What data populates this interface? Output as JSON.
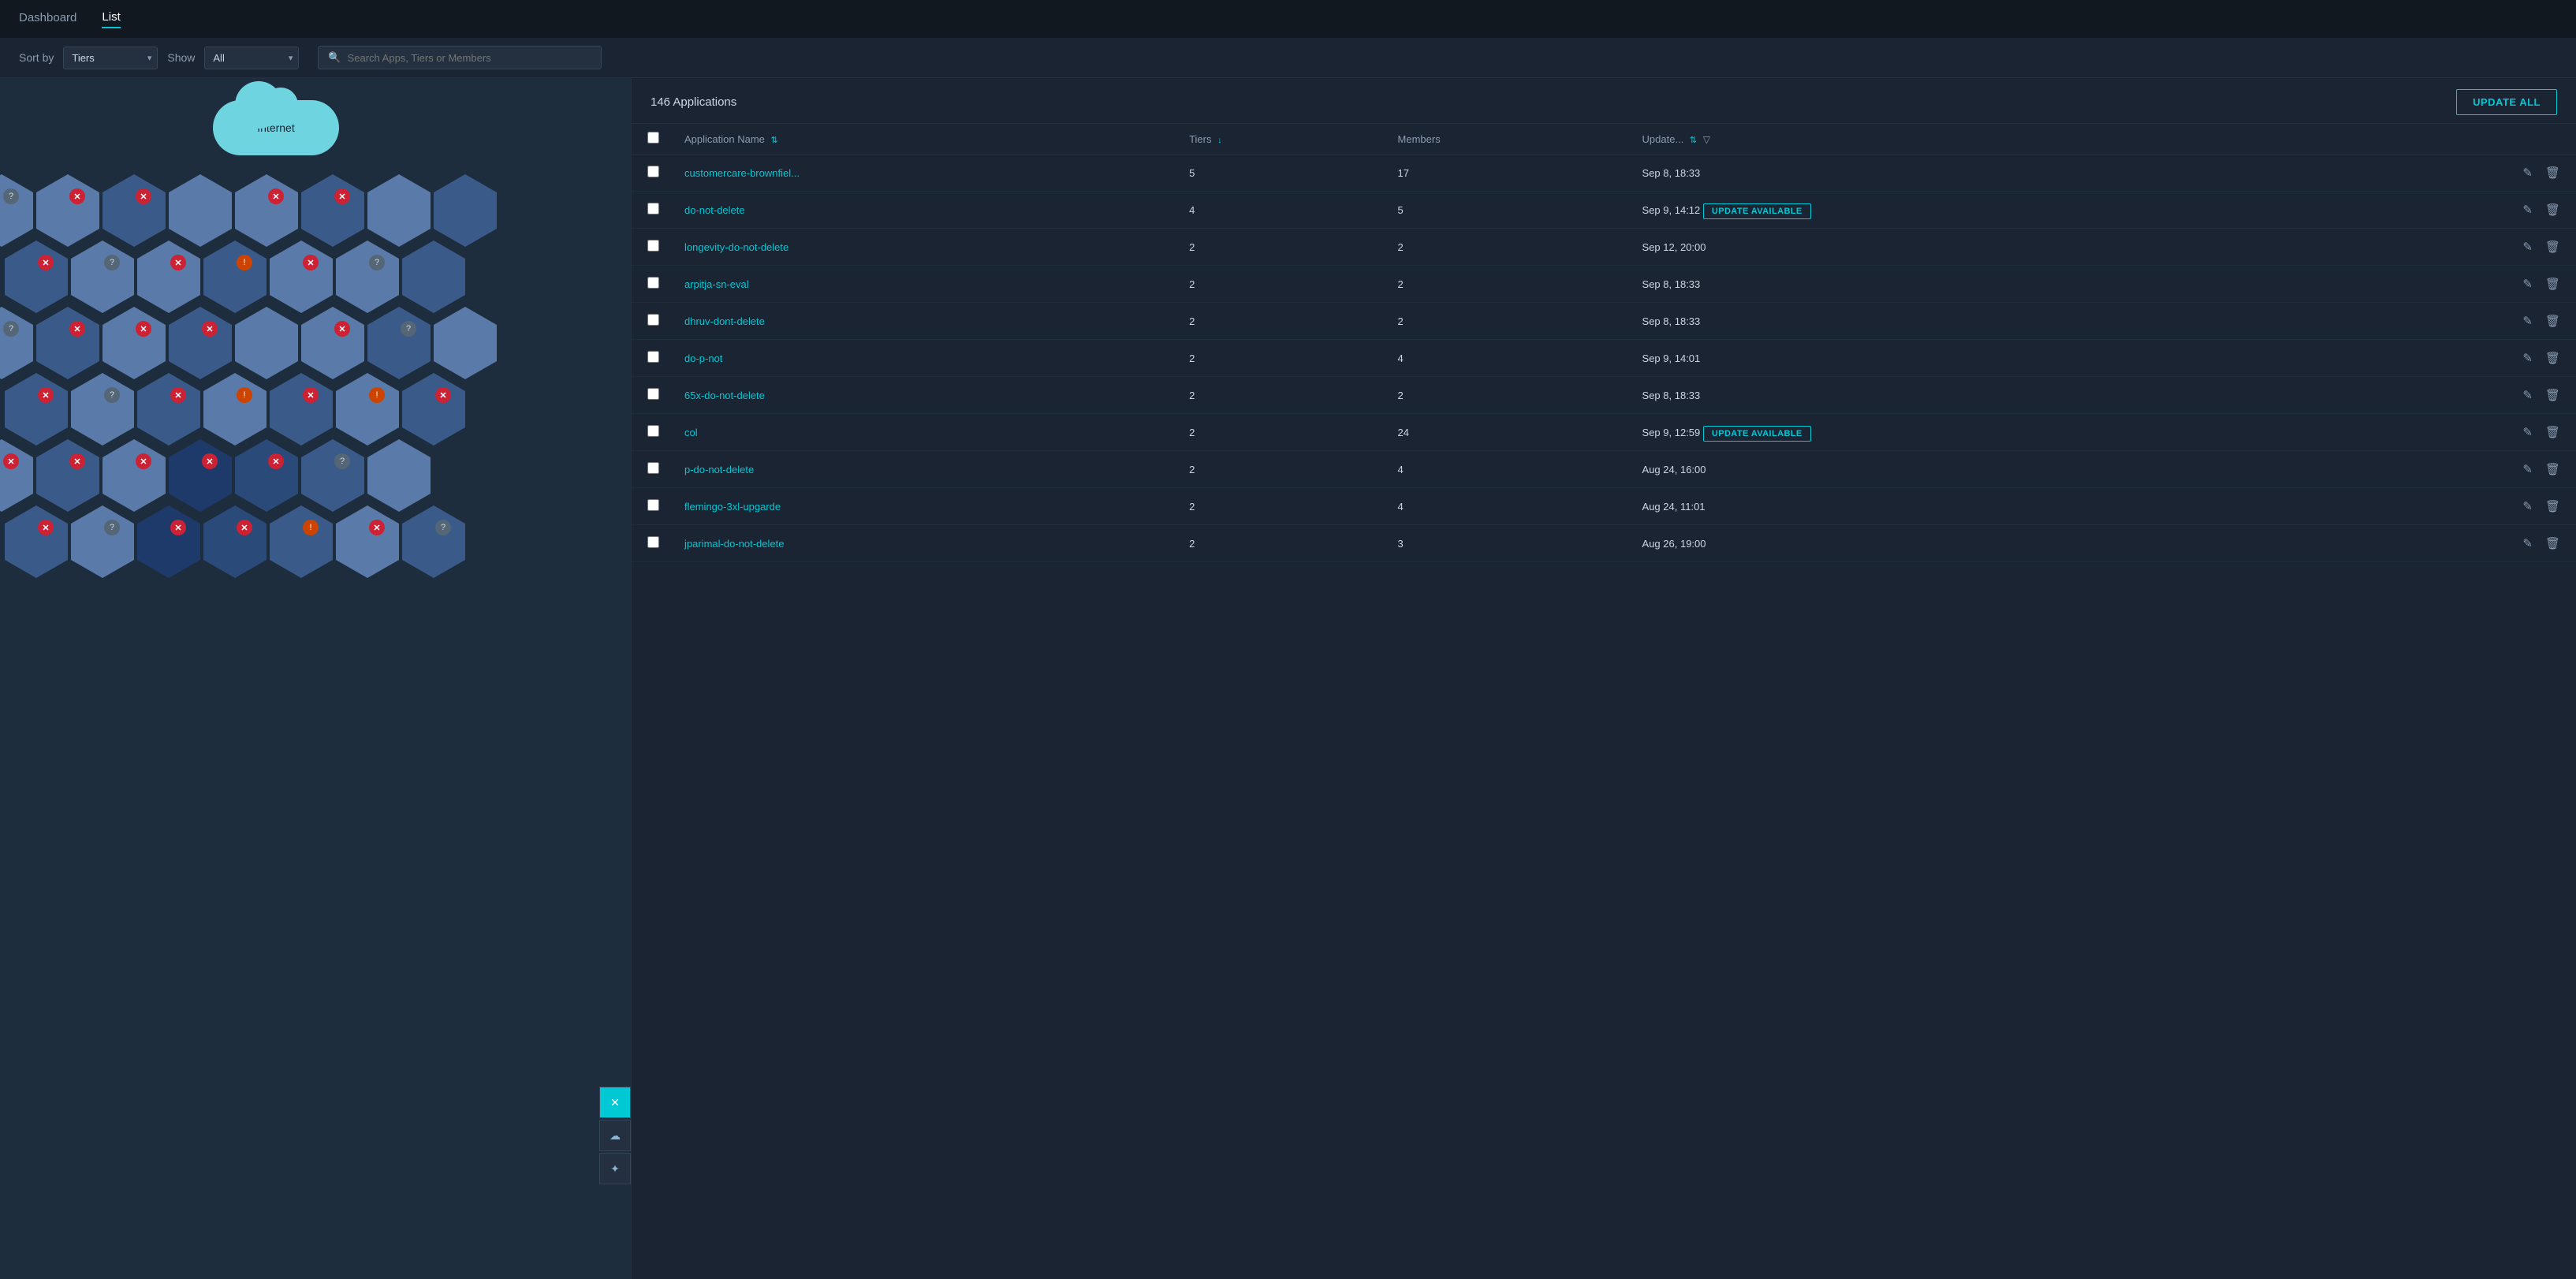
{
  "nav": {
    "items": [
      {
        "id": "dashboard",
        "label": "Dashboard",
        "active": false
      },
      {
        "id": "list",
        "label": "List",
        "active": true
      }
    ]
  },
  "toolbar": {
    "sort_by_label": "Sort by",
    "sort_value": "Tiers",
    "show_label": "Show",
    "show_value": "All",
    "search_placeholder": "Search Apps, Tiers or Members"
  },
  "hex_panel": {
    "cloud_label": "Internet"
  },
  "table": {
    "count_label": "146 Applications",
    "update_all_label": "UPDATE ALL",
    "columns": {
      "checkbox": "",
      "app_name": "Application Name",
      "tiers": "Tiers",
      "members": "Members",
      "updated": "Update..."
    },
    "rows": [
      {
        "id": 1,
        "name": "customercare-brownfiel...",
        "tiers": 5,
        "members": 17,
        "updated": "Sep 8, 18:33",
        "has_update": false
      },
      {
        "id": 2,
        "name": "do-not-delete",
        "tiers": 4,
        "members": 5,
        "updated": "Sep 9, 14:12",
        "has_update": true
      },
      {
        "id": 3,
        "name": "longevity-do-not-delete",
        "tiers": 2,
        "members": 2,
        "updated": "Sep 12, 20:00",
        "has_update": false
      },
      {
        "id": 4,
        "name": "arpitja-sn-eval",
        "tiers": 2,
        "members": 2,
        "updated": "Sep 8, 18:33",
        "has_update": false
      },
      {
        "id": 5,
        "name": "dhruv-dont-delete",
        "tiers": 2,
        "members": 2,
        "updated": "Sep 8, 18:33",
        "has_update": false
      },
      {
        "id": 6,
        "name": "do-p-not",
        "tiers": 2,
        "members": 4,
        "updated": "Sep 9, 14:01",
        "has_update": false
      },
      {
        "id": 7,
        "name": "65x-do-not-delete",
        "tiers": 2,
        "members": 2,
        "updated": "Sep 8, 18:33",
        "has_update": false
      },
      {
        "id": 8,
        "name": "col",
        "tiers": 2,
        "members": 24,
        "updated": "Sep 9, 12:59",
        "has_update": true
      },
      {
        "id": 9,
        "name": "p-do-not-delete",
        "tiers": 2,
        "members": 4,
        "updated": "Aug 24, 16:00",
        "has_update": false
      },
      {
        "id": 10,
        "name": "flemingo-3xl-upgarde",
        "tiers": 2,
        "members": 4,
        "updated": "Aug 24, 11:01",
        "has_update": false
      },
      {
        "id": 11,
        "name": "jparimal-do-not-delete",
        "tiers": 2,
        "members": 3,
        "updated": "Aug 26, 19:00",
        "has_update": false
      }
    ],
    "update_available_label": "UPDATE AVAILABLE"
  }
}
